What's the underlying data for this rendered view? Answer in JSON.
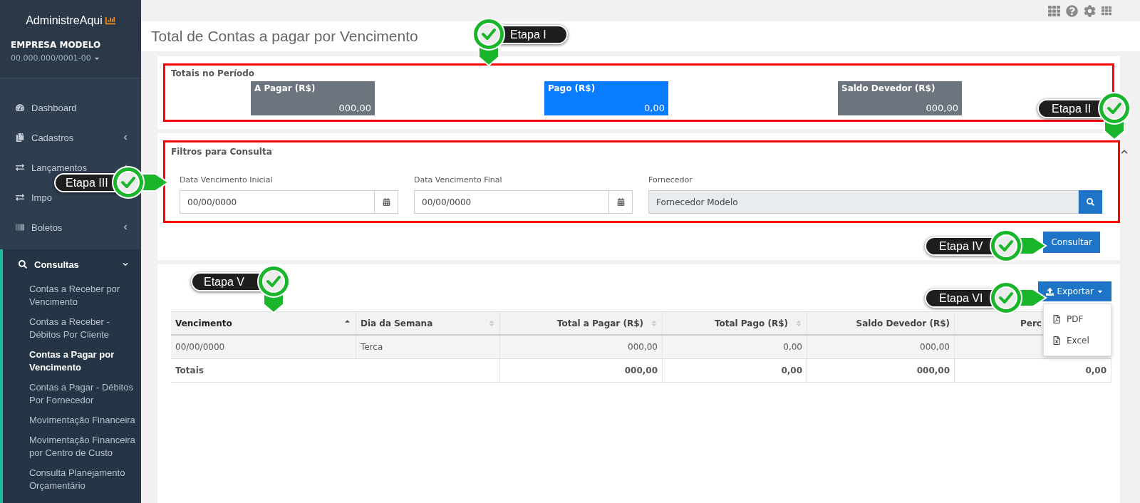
{
  "sidebar": {
    "logo": "AdministreAqui",
    "company": {
      "name": "EMPRESA MODELO",
      "document": "00.000.000/0001-00"
    },
    "items": [
      {
        "label": "Dashboard",
        "kind": "link"
      },
      {
        "label": "Cadastros",
        "kind": "group",
        "expanded": false
      },
      {
        "label": "Lançamentos",
        "kind": "group",
        "expanded": false
      },
      {
        "label": "Impo",
        "kind": "link"
      },
      {
        "label": "Boletos",
        "kind": "group",
        "expanded": false
      },
      {
        "label": "Consultas",
        "kind": "group",
        "expanded": true,
        "children": [
          {
            "label": "Contas a Receber por Vencimento",
            "selected": false
          },
          {
            "label": "Contas a Receber - Débitos Por Cliente",
            "selected": false
          },
          {
            "label": "Contas a Pagar por Vencimento",
            "selected": true
          },
          {
            "label": "Contas a Pagar - Débitos Por Fornecedor",
            "selected": false
          },
          {
            "label": "Movimentação Financeira",
            "selected": false
          },
          {
            "label": "Movimentação Financeira por Centro de Custo",
            "selected": false
          },
          {
            "label": "Consulta Planejamento Orçamentário",
            "selected": false
          }
        ]
      }
    ]
  },
  "page_title": "Total de Contas a pagar por Vencimento",
  "totals": {
    "title": "Totais no Período",
    "highlighted": true,
    "cards": [
      {
        "label": "A Pagar (R$)",
        "value": "000,00",
        "color": "#6c757d"
      },
      {
        "label": "Pago (R$)",
        "value": "0,00",
        "color": "#0a7cff"
      },
      {
        "label": "Saldo Devedor (R$)",
        "value": "000,00",
        "color": "#6c757d"
      }
    ]
  },
  "filters": {
    "title": "Filtros para Consulta",
    "highlighted": true,
    "expanded": true,
    "fields": [
      {
        "label": "Data Vencimento Inicial",
        "value": "00/00/0000",
        "kind": "date"
      },
      {
        "label": "Data Vencimento Final",
        "value": "00/00/0000",
        "kind": "date"
      },
      {
        "label": "Fornecedor",
        "value": "Fornecedor Modelo",
        "kind": "lookup"
      }
    ],
    "button": "Consultar"
  },
  "export": {
    "button": "Exportar",
    "menu": [
      "PDF",
      "Excel"
    ]
  },
  "table": {
    "columns": [
      {
        "label": "Vencimento",
        "sortable": true,
        "active": true
      },
      {
        "label": "Dia da Semana",
        "sortable": true,
        "active": false
      },
      {
        "label": "Total a Pagar (R$)",
        "sortable": true,
        "active": false
      },
      {
        "label": "Total Pago (R$)",
        "sortable": true,
        "active": false
      },
      {
        "label": "Saldo Devedor (R$)",
        "sortable": false,
        "active": false
      },
      {
        "label": "Perc"
      }
    ],
    "rows": [
      [
        "00/00/0000",
        "Terca",
        "000,00",
        "0,00",
        "000,00"
      ]
    ],
    "totals": {
      "label": "Totais",
      "values": [
        "000,00",
        "0,00",
        "000,00",
        "0,00"
      ]
    }
  },
  "callouts": [
    {
      "label": "Etapa I",
      "kind": "down"
    },
    {
      "label": "Etapa II",
      "kind": "down"
    },
    {
      "label": "Etapa III",
      "kind": "right"
    },
    {
      "label": "Etapa IV",
      "kind": "right"
    },
    {
      "label": "Etapa V",
      "kind": "down"
    },
    {
      "label": "Etapa VI",
      "kind": "right"
    }
  ]
}
